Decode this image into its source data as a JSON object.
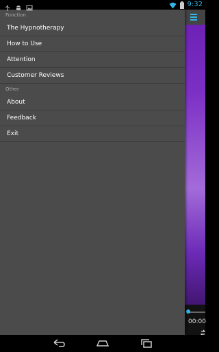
{
  "status_bar": {
    "time": "9:32",
    "icons": [
      "usb-icon",
      "android-icon",
      "image-icon",
      "wifi-icon",
      "battery-icon"
    ],
    "time_color": "#33b5e5"
  },
  "drawer": {
    "sections": [
      {
        "header": "Function",
        "items": [
          "The Hypnotherapy",
          "How to Use",
          "Attention",
          "Customer Reviews"
        ]
      },
      {
        "header": "Other",
        "items": [
          "About",
          "Feedback",
          "Exit"
        ]
      }
    ]
  },
  "player": {
    "elapsed": "00:00",
    "accent": "#33b5e5"
  },
  "nav": {
    "icons": [
      "back-icon",
      "home-icon",
      "recent-apps-icon"
    ]
  }
}
